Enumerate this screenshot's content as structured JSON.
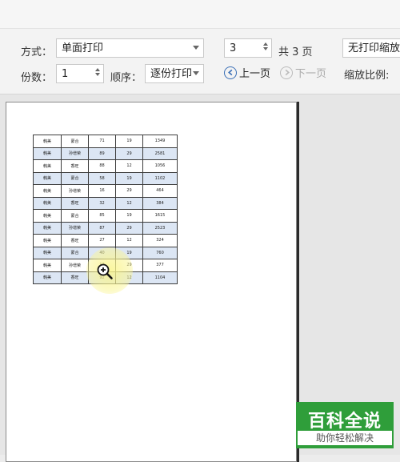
{
  "toolbar": {
    "mode_label": "方式：",
    "mode_value": "单面打印",
    "copies_label": "份数：",
    "copies_value": "1",
    "order_label": "顺序：",
    "order_value": "逐份打印",
    "page_value": "3",
    "page_total": "共 3 页",
    "prev_label": "上一页",
    "next_label": "下一页",
    "scale_select": "无打印缩放",
    "scale_label": "缩放比例:"
  },
  "sheet": {
    "rows": [
      [
        "韩美",
        "蒙合",
        "71",
        "19",
        "1349"
      ],
      [
        "韩美",
        "孙增荣",
        "89",
        "29",
        "2581"
      ],
      [
        "韩美",
        "香旺",
        "88",
        "12",
        "1056"
      ],
      [
        "韩美",
        "蒙合",
        "58",
        "19",
        "1102"
      ],
      [
        "韩美",
        "孙增荣",
        "16",
        "29",
        "464"
      ],
      [
        "韩美",
        "香旺",
        "32",
        "12",
        "384"
      ],
      [
        "韩美",
        "蒙合",
        "85",
        "19",
        "1615"
      ],
      [
        "韩美",
        "孙增荣",
        "87",
        "29",
        "2523"
      ],
      [
        "韩美",
        "香旺",
        "27",
        "12",
        "324"
      ],
      [
        "韩美",
        "蒙合",
        "40",
        "19",
        "760"
      ],
      [
        "韩美",
        "孙增荣",
        "13",
        "29",
        "377"
      ],
      [
        "韩美",
        "香旺",
        "92",
        "12",
        "1104"
      ]
    ]
  },
  "watermark": {
    "title": "百科全说",
    "subtitle": "助你轻松解决"
  },
  "colors": {
    "accent": "#3a6fb6",
    "row_stripe": "#dce6f4",
    "watermark_green": "#2f9e3a"
  }
}
